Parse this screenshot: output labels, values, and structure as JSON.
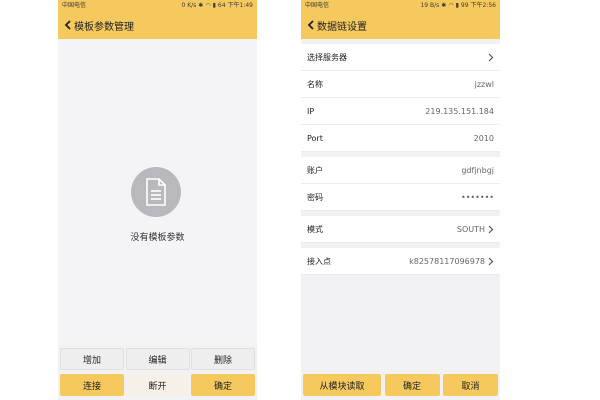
{
  "colors": {
    "accent": "#f6c95f",
    "background": "#f2f2f4",
    "icon_grey": "#b9b8bc"
  },
  "left": {
    "status": {
      "carrier": "中国电信",
      "network": "0 K/s",
      "battery": "64",
      "time": "下午1:49"
    },
    "title": "模板参数管理",
    "empty_text": "没有模板参数",
    "icons": {
      "back": "chevron-left-icon",
      "empty": "document-icon"
    },
    "buttons_row1": [
      "增加",
      "编辑",
      "删除"
    ],
    "buttons_row2": [
      "连接",
      "断开",
      "确定"
    ]
  },
  "right": {
    "status": {
      "carrier": "中国电信",
      "network": "19 B/s",
      "battery": "99",
      "time": "下午2:56"
    },
    "title": "数据链设置",
    "rows": {
      "server": {
        "label": "选择服务器",
        "value": ""
      },
      "name": {
        "label": "名称",
        "value": "jzzwl"
      },
      "ip": {
        "label": "IP",
        "value": "219.135.151.184"
      },
      "port": {
        "label": "Port",
        "value": "2010"
      },
      "account": {
        "label": "账户",
        "value": "gdfjnbgj"
      },
      "password": {
        "label": "密码",
        "value": "•••••••"
      },
      "mode": {
        "label": "模式",
        "value": "SOUTH"
      },
      "access_point": {
        "label": "接入点",
        "value": "k82578117096978"
      }
    },
    "buttons": [
      "从模块读取",
      "确定",
      "取消"
    ]
  }
}
